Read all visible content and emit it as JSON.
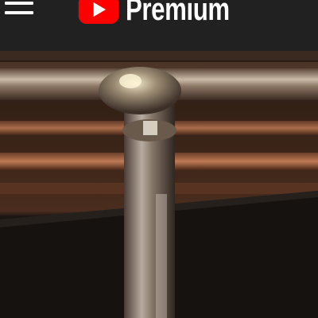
{
  "header": {
    "menu_icon": "hamburger-menu-icon",
    "logo_icon": "youtube-play-icon",
    "logo_text": "Premium",
    "background_color": "#212121",
    "brand_color": "#ff0000"
  },
  "player": {
    "content": "video-frame"
  }
}
